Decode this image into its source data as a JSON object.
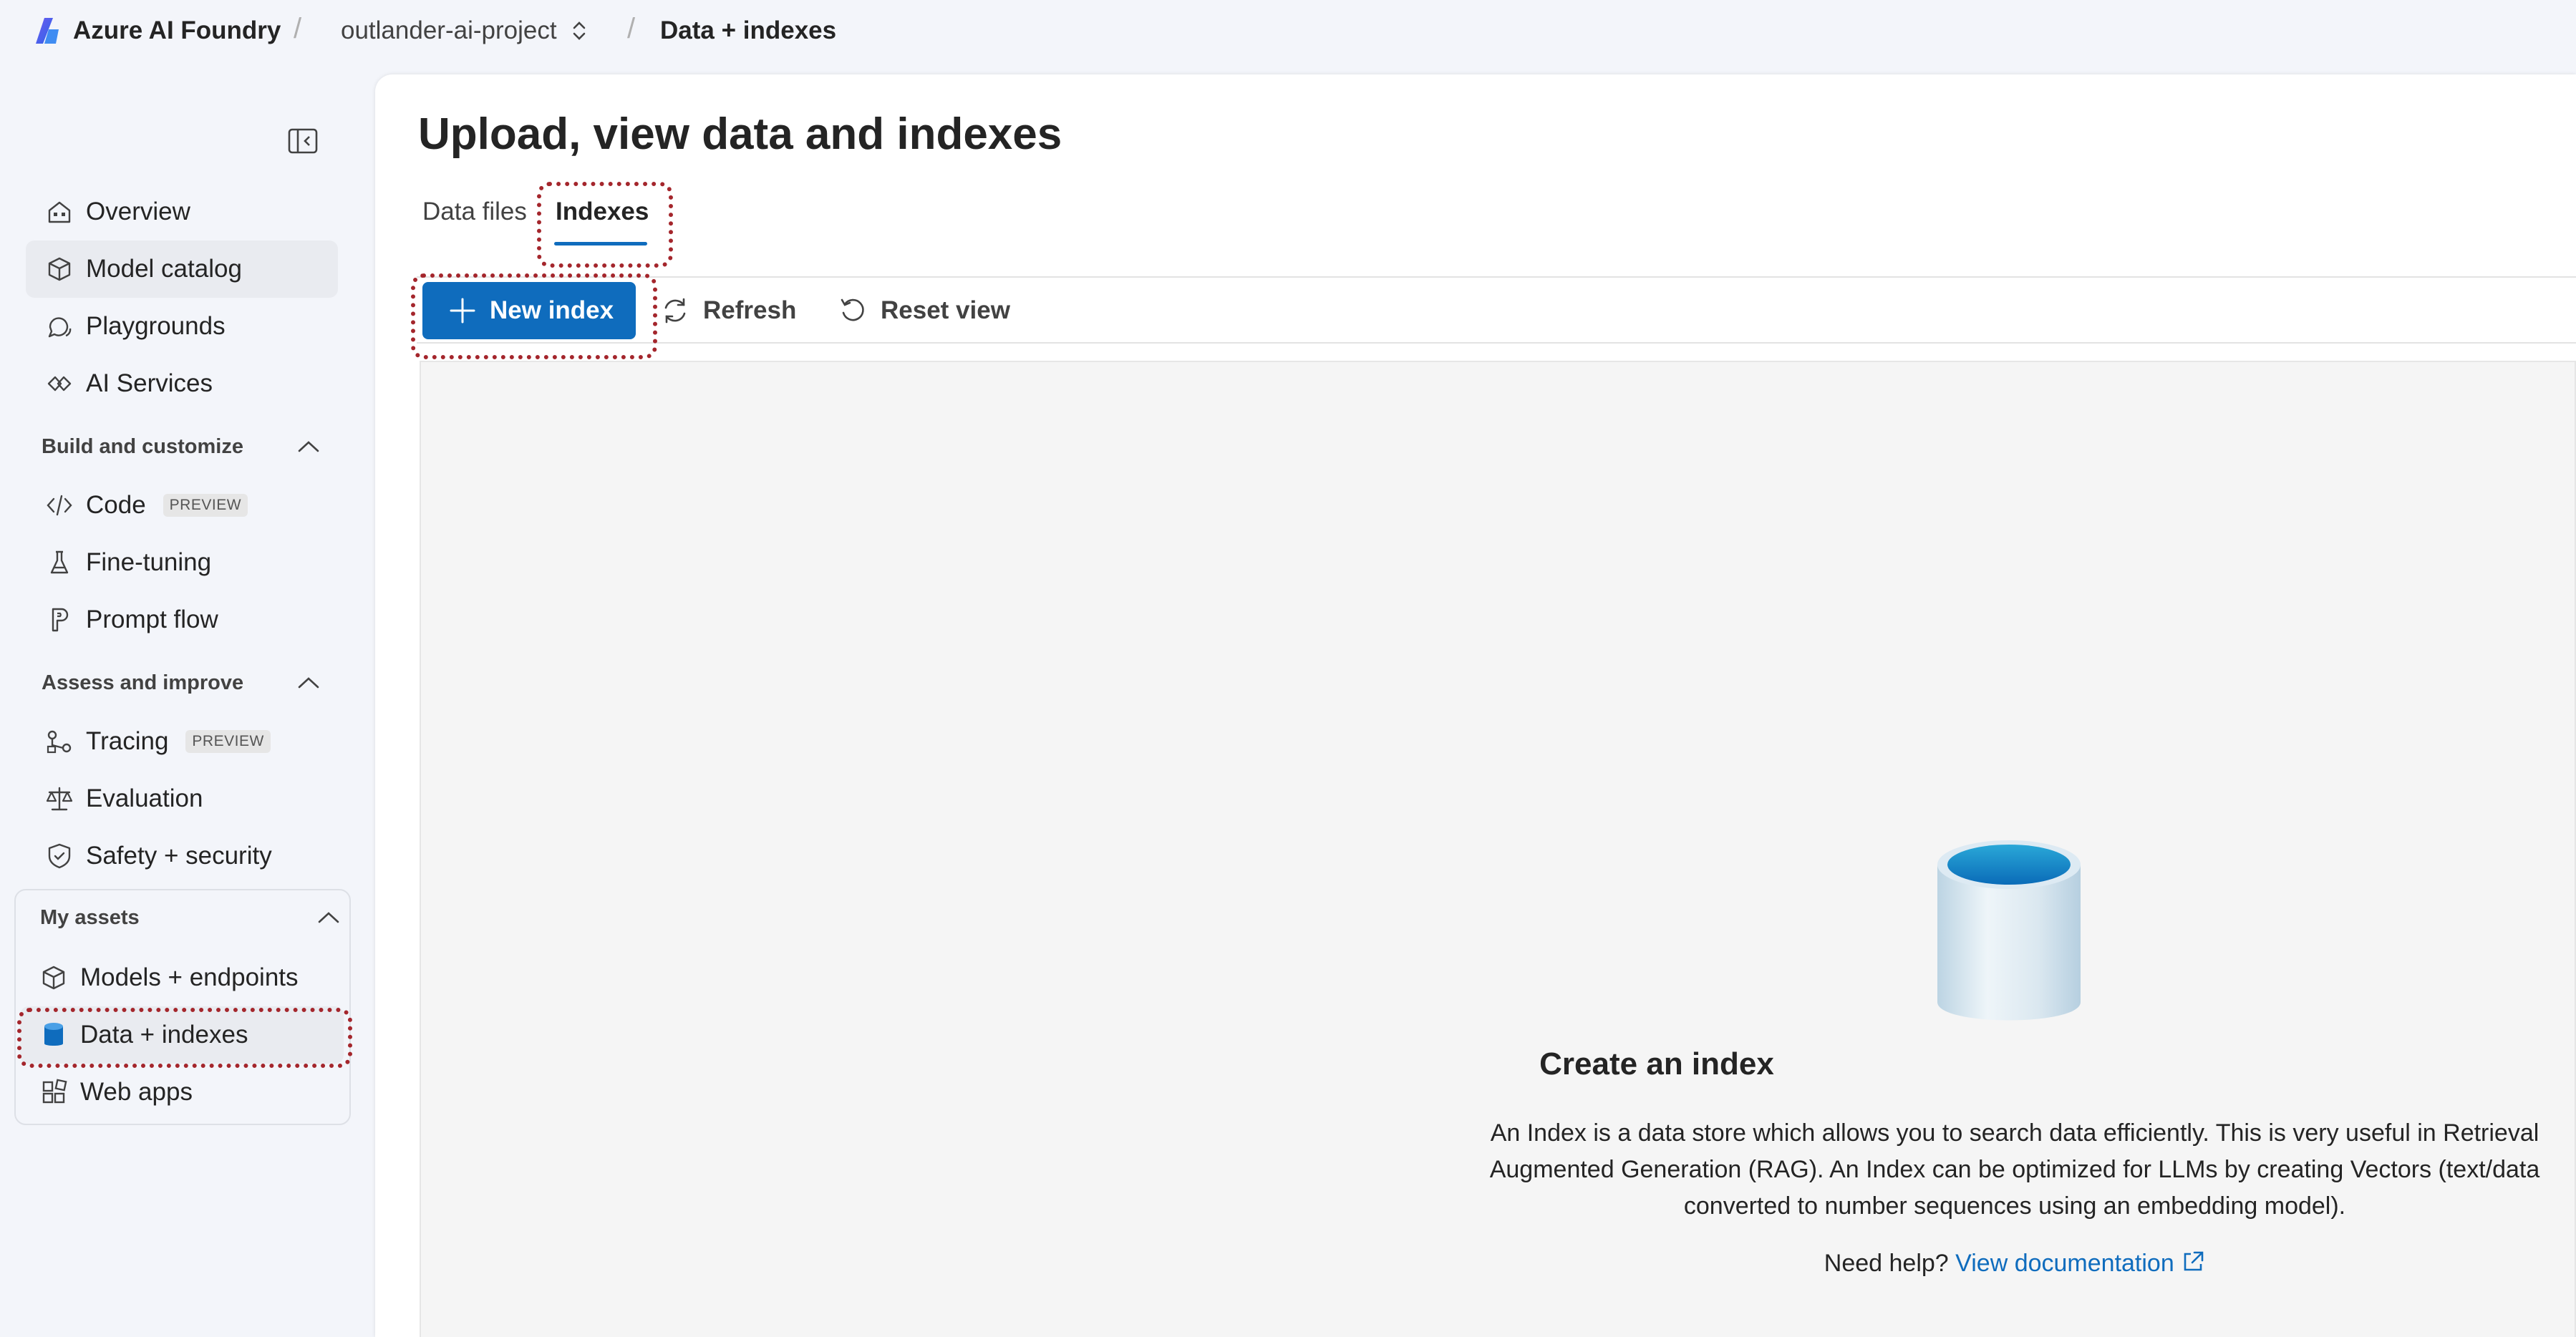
{
  "topbar": {
    "brand": "Azure AI Foundry",
    "project": "outlander-ai-project",
    "current_page": "Data + indexes",
    "separator": "/"
  },
  "sidebar": {
    "collapse_icon": "collapse-sidebar-icon",
    "top_items": [
      {
        "label": "Overview",
        "icon": "home-icon"
      },
      {
        "label": "Model catalog",
        "icon": "cube-catalog-icon"
      },
      {
        "label": "Playgrounds",
        "icon": "chat-bubbles-icon"
      },
      {
        "label": "AI Services",
        "icon": "link-services-icon"
      }
    ],
    "sections": [
      {
        "title": "Build and customize",
        "items": [
          {
            "label": "Code",
            "badge": "PREVIEW",
            "icon": "code-icon"
          },
          {
            "label": "Fine-tuning",
            "icon": "flask-icon"
          },
          {
            "label": "Prompt flow",
            "icon": "flow-icon"
          }
        ]
      },
      {
        "title": "Assess and improve",
        "items": [
          {
            "label": "Tracing",
            "badge": "PREVIEW",
            "icon": "tracing-icon"
          },
          {
            "label": "Evaluation",
            "icon": "scales-icon"
          },
          {
            "label": "Safety + security",
            "icon": "shield-icon"
          }
        ]
      }
    ],
    "assets": {
      "title": "My assets",
      "items": [
        {
          "label": "Models + endpoints",
          "icon": "box-icon"
        },
        {
          "label": "Data + indexes",
          "icon": "database-icon"
        },
        {
          "label": "Web apps",
          "icon": "web-apps-icon"
        }
      ]
    }
  },
  "main": {
    "title": "Upload, view data and indexes",
    "tabs": [
      {
        "label": "Data files",
        "active": false
      },
      {
        "label": "Indexes",
        "active": true
      }
    ],
    "toolbar": {
      "new_index": "New index",
      "refresh": "Refresh",
      "reset_view": "Reset view"
    },
    "empty_state": {
      "icon": "database-illustration",
      "title": "Create an index",
      "description": "An Index is a data store which allows you to search data efficiently. This is very useful in Retrieval Augmented Generation (RAG). An Index can be optimized for LLMs by creating Vectors (text/data converted to number sequences using an embedding model).",
      "help_prefix": "Need help?",
      "help_link": "View documentation"
    }
  },
  "colors": {
    "accent": "#0f6cbd",
    "callout": "#a4262c",
    "sidebar_bg": "#f3f5fa",
    "canvas_bg": "#f5f5f5"
  }
}
